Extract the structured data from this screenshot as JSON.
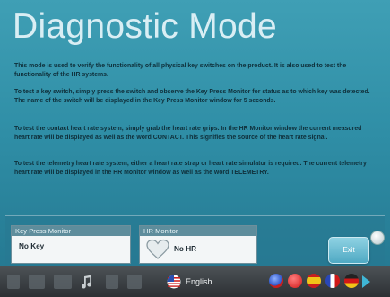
{
  "page": {
    "title": "Diagnostic Mode",
    "paragraphs": [
      "This mode is used to verify the functionality of all physical key switches on the product.  It is also used to test the functionality of the HR systems.",
      "To test a key switch, simply press the switch and observe the Key Press Monitor for status as to which key was detected.  The name of the switch will be displayed in the Key Press Monitor window for 5 seconds.",
      "To test the contact heart rate system, simply grab the heart rate grips.  In the HR Monitor window the current measured heart rate will be displayed as well as the word CONTACT. This signifies the source of the heart rate signal.",
      "To test the telemetry heart rate system, either a heart rate strap or heart rate simulator is required.  The current telemetry heart rate will be displayed in the HR Monitor window as well as the word TELEMETRY."
    ]
  },
  "monitors": {
    "key_press": {
      "label": "Key Press Monitor",
      "value": "No Key"
    },
    "hr": {
      "label": "HR Monitor",
      "value": "No HR",
      "icon": "heart-icon"
    }
  },
  "buttons": {
    "exit_label": "Exit"
  },
  "taskbar": {
    "language_label": "English",
    "flags": [
      "us-flag-icon",
      "canada-flag-icon",
      "spain-flag-icon",
      "france-flag-icon",
      "germany-flag-icon"
    ]
  },
  "colors": {
    "background": "#2f8ea6",
    "title": "#d9eef4",
    "taskbar": "#3a3f43"
  }
}
